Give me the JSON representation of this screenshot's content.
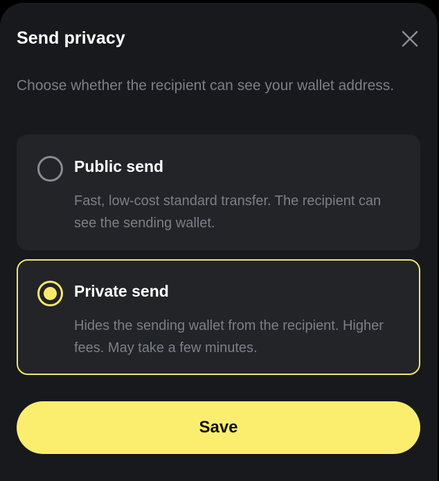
{
  "dialog": {
    "title": "Send privacy",
    "subtitle": "Choose whether the recipient can see your wallet address.",
    "close_icon": "close-icon"
  },
  "options": [
    {
      "label": "Public send",
      "description": "Fast, low-cost standard transfer. The recipient can see the sending wallet.",
      "selected": false
    },
    {
      "label": "Private send",
      "description": "Hides the sending wallet from the recipient. Higher fees. May take a few minutes.",
      "selected": true
    }
  ],
  "save_label": "Save",
  "colors": {
    "background": "#18191d",
    "card": "#222428",
    "accent": "#fbee6e",
    "muted_text": "#7c7f87"
  }
}
